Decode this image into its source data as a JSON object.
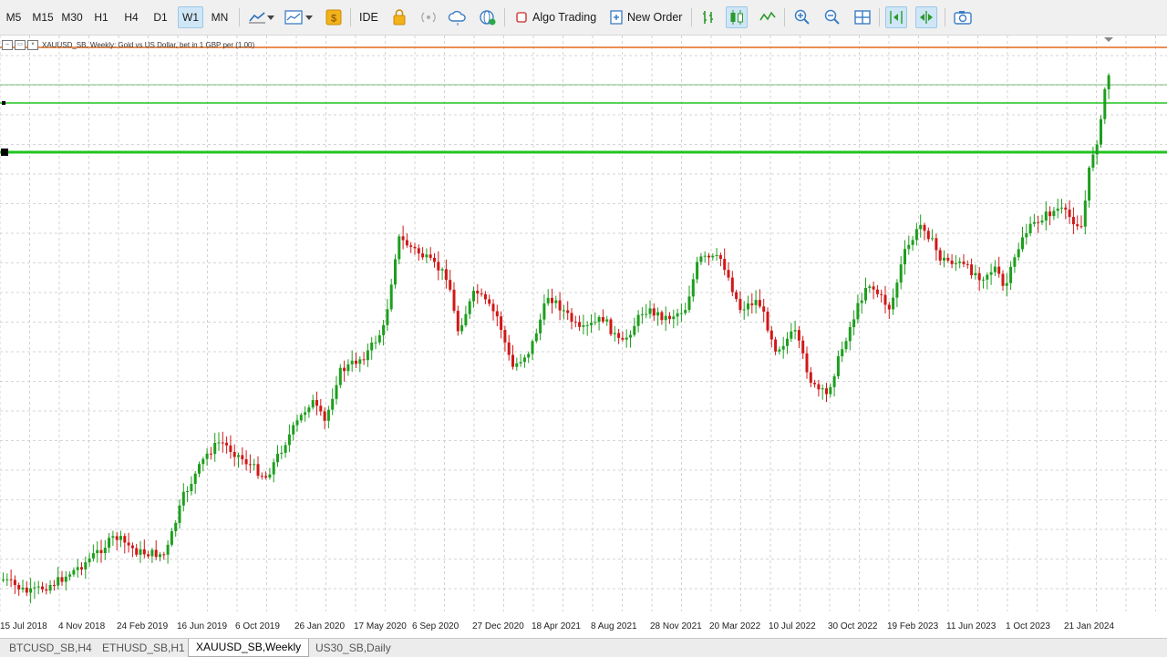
{
  "toolbar": {
    "timeframes": [
      "M5",
      "M15",
      "M30",
      "H1",
      "H4",
      "D1",
      "W1",
      "MN"
    ],
    "active_timeframe": "W1",
    "ide_label": "IDE",
    "algo_trading_label": "Algo Trading",
    "new_order_label": "New Order"
  },
  "chart": {
    "header": "XAUUSD_SB, Weekly:  Gold vs US Dollar, bet in 1 GBP per (1.00)",
    "colors": {
      "bull": "#1e9e1e",
      "bear": "#d01818",
      "grid": "#c9c9c9",
      "hline_red": "#e06a1a",
      "hline_green": "#22c422"
    },
    "x_labels": [
      "15 Jul 2018",
      "4 Nov 2018",
      "24 Feb 2019",
      "16 Jun 2019",
      "6 Oct 2019",
      "26 Jan 2020",
      "17 May 2020",
      "6 Sep 2020",
      "27 Dec 2020",
      "18 Apr 2021",
      "8 Aug 2021",
      "28 Nov 2021",
      "20 Mar 2022",
      "10 Jul 2022",
      "30 Oct 2022",
      "19 Feb 2023",
      "11 Jun 2023",
      "1 Oct 2023",
      "21 Jan 2024"
    ]
  },
  "tabs": [
    {
      "label": "BTCUSD_SB,H4",
      "active": false
    },
    {
      "label": "ETHUSD_SB,H1",
      "active": false
    },
    {
      "label": "XAUUSD_SB,Weekly",
      "active": true
    },
    {
      "label": "US30_SB,Daily",
      "active": false
    }
  ]
}
